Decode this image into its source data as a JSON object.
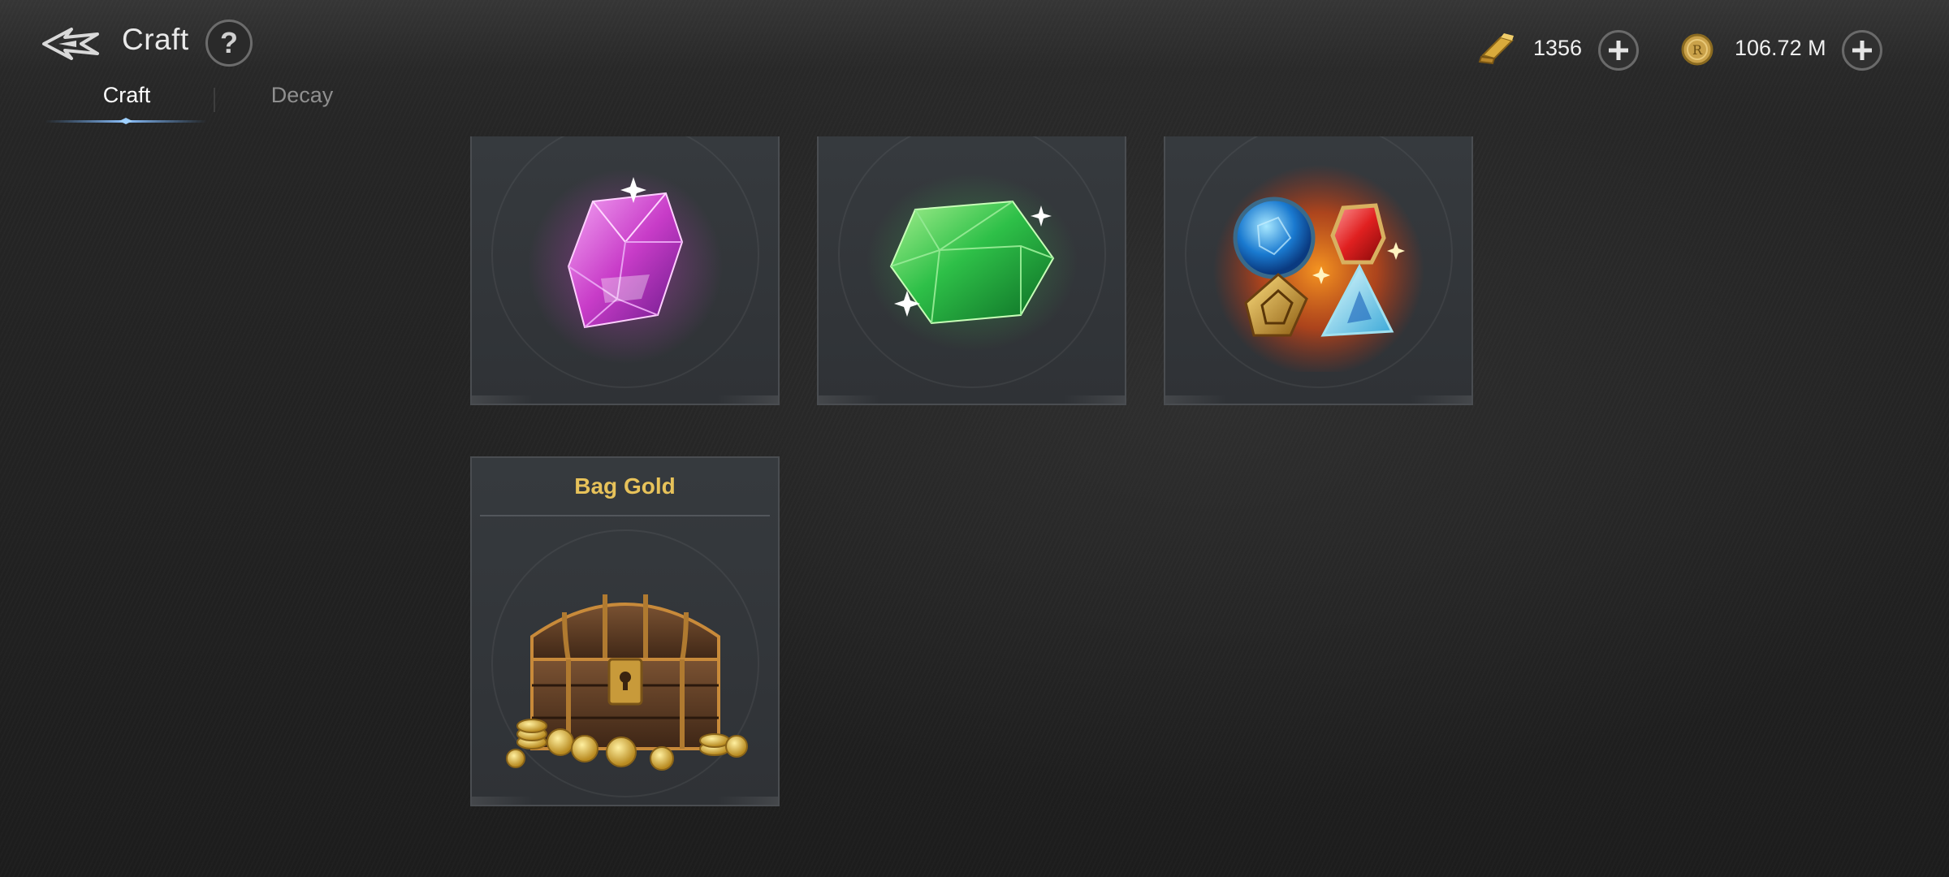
{
  "header": {
    "title": "Craft",
    "help_symbol": "?",
    "back_icon": "back-arrow-icon"
  },
  "tabs": [
    {
      "label": "Craft",
      "active": true
    },
    {
      "label": "Decay",
      "active": false
    }
  ],
  "currencies": [
    {
      "icon": "scroll-ticket-icon",
      "value": "1356"
    },
    {
      "icon": "gold-coin-icon",
      "value": "106.72 M"
    }
  ],
  "cards": [
    {
      "icon": "pink-crystal-icon",
      "label": ""
    },
    {
      "icon": "green-crystal-icon",
      "label": ""
    },
    {
      "icon": "gem-set-icon",
      "label": ""
    },
    {
      "icon": "treasure-chest-icon",
      "label": "Bag Gold"
    }
  ],
  "colors": {
    "accent_gold": "#e7c25a",
    "tab_active": "#ffffff",
    "tab_inactive": "#8f8f8f",
    "underline_blue": "#5a9be6"
  }
}
